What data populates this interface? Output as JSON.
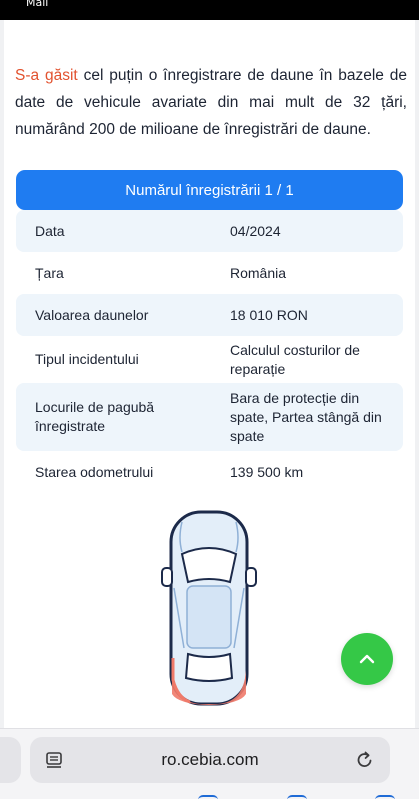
{
  "status_bar": {
    "carrier": "Mail"
  },
  "intro": {
    "highlight": "S-a găsit",
    "text": " cel puțin o înregistrare de daune în bazele de date de vehicule avariate din mai mult de 32 țări, numărând 200 de milioane de înregistrări de daune."
  },
  "record": {
    "header": "Numărul înregistrării 1 / 1",
    "rows": [
      {
        "key": "Data",
        "value": "04/2024"
      },
      {
        "key": "Țara",
        "value": "România"
      },
      {
        "key": "Valoarea daunelor",
        "value": "18 010 RON"
      },
      {
        "key": "Tipul incidentului",
        "value": "Calculul costurilor de reparație"
      },
      {
        "key": "Locurile de pagubă înregistrate",
        "value": "Bara de protecție din spate, Partea stângă din spate"
      },
      {
        "key": "Starea odometrului",
        "value": "139 500 km"
      }
    ]
  },
  "damage_diagram": {
    "damaged_zones": [
      "rear-bumper",
      "rear-left"
    ],
    "damage_color": "#f07a6a"
  },
  "scroll_top_button": {
    "icon": "chevron-up-icon",
    "color": "#35c847"
  },
  "browser": {
    "url": "ro.cebia.com",
    "reader_icon": "reader-icon",
    "reload_icon": "reload-icon"
  },
  "colors": {
    "accent": "#1f7cf1",
    "highlight": "#e2522f",
    "row_shade": "#eef5fb"
  }
}
